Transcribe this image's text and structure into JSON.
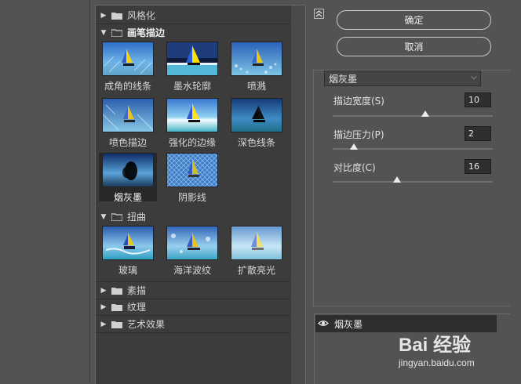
{
  "gallery": {
    "categories": [
      {
        "label": "风格化",
        "expanded": false
      },
      {
        "label": "画笔描边",
        "expanded": true
      },
      {
        "label": "扭曲",
        "expanded": true
      },
      {
        "label": "素描",
        "expanded": false
      },
      {
        "label": "纹理",
        "expanded": false
      },
      {
        "label": "艺术效果",
        "expanded": false
      }
    ],
    "brush_filters": [
      "成角的线条",
      "墨水轮廓",
      "喷溅",
      "喷色描边",
      "强化的边缘",
      "深色线条",
      "烟灰墨",
      "阴影线"
    ],
    "distort_filters": [
      "玻璃",
      "海洋波纹",
      "扩散亮光"
    ],
    "selected": "烟灰墨"
  },
  "buttons": {
    "ok": "确定",
    "cancel": "取消"
  },
  "filter_select": {
    "value": "烟灰墨"
  },
  "params": [
    {
      "label": "描边宽度(S)",
      "value": "10",
      "fraction": 0.58
    },
    {
      "label": "描边压力(P)",
      "value": "2",
      "fraction": 0.13
    },
    {
      "label": "对比度(C)",
      "value": "16",
      "fraction": 0.4
    }
  ],
  "layers": {
    "name": "烟灰墨"
  },
  "watermark": {
    "logo": "Bai 经验",
    "url": "jingyan.baidu.com"
  },
  "colors": {
    "panel": "#535353",
    "gallery_bg": "#3c3c3c",
    "selection": "#282828"
  }
}
